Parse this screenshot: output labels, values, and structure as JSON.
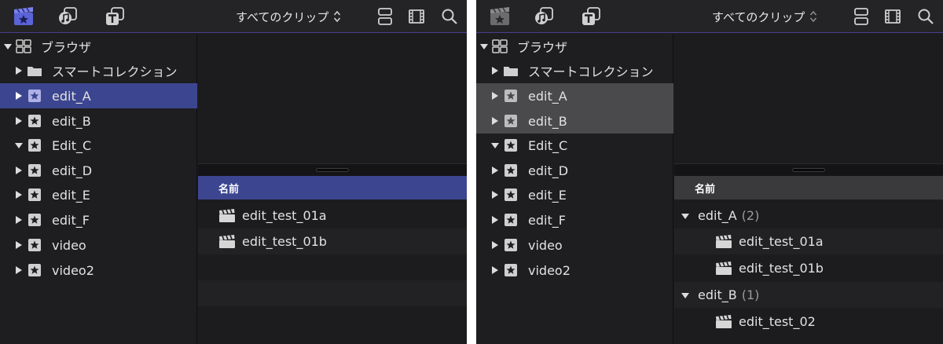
{
  "colors": {
    "accent": "#3c4690",
    "background": "#1c1c1e",
    "selection_gray": "#4a4a4c"
  },
  "toolbar": {
    "icons": [
      "library-icon",
      "photos-audio-icon",
      "titles-icon",
      "clip-layout-icon",
      "filmstrip-icon",
      "search-icon"
    ],
    "filter_label": "すべてのクリップ"
  },
  "panel_a": {
    "sidebar": {
      "items": [
        {
          "label": "ブラウザ",
          "expanded": true,
          "icon": "browser-grid-icon"
        },
        {
          "label": "スマートコレクション",
          "expanded": false,
          "icon": "folder-icon"
        },
        {
          "label": "edit_A",
          "expanded": false,
          "icon": "event-star-icon",
          "selected": true
        },
        {
          "label": "edit_B",
          "expanded": false,
          "icon": "event-star-icon"
        },
        {
          "label": "Edit_C",
          "expanded": true,
          "icon": "event-star-icon"
        },
        {
          "label": "edit_D",
          "expanded": false,
          "icon": "event-star-icon"
        },
        {
          "label": "edit_E",
          "expanded": false,
          "icon": "event-star-icon"
        },
        {
          "label": "edit_F",
          "expanded": false,
          "icon": "event-star-icon"
        },
        {
          "label": "video",
          "expanded": false,
          "icon": "event-star-icon"
        },
        {
          "label": "video2",
          "expanded": false,
          "icon": "event-star-icon"
        }
      ]
    },
    "list": {
      "header": "名前",
      "rows": [
        {
          "label": "edit_test_01a"
        },
        {
          "label": "edit_test_01b"
        }
      ]
    }
  },
  "panel_b": {
    "sidebar": {
      "items": [
        {
          "label": "ブラウザ",
          "expanded": true
        },
        {
          "label": "スマートコレクション",
          "expanded": false
        },
        {
          "label": "edit_A",
          "expanded": false,
          "selected": true
        },
        {
          "label": "edit_B",
          "expanded": false,
          "selected": true
        },
        {
          "label": "Edit_C",
          "expanded": true
        },
        {
          "label": "edit_D",
          "expanded": false
        },
        {
          "label": "edit_E",
          "expanded": false
        },
        {
          "label": "edit_F",
          "expanded": false
        },
        {
          "label": "video",
          "expanded": false
        },
        {
          "label": "video2",
          "expanded": false
        }
      ]
    },
    "list": {
      "header": "名前",
      "groups": [
        {
          "label": "edit_A",
          "count": "(2)",
          "clips": [
            "edit_test_01a",
            "edit_test_01b"
          ]
        },
        {
          "label": "edit_B",
          "count": "(1)",
          "clips": [
            "edit_test_02"
          ]
        }
      ]
    }
  }
}
